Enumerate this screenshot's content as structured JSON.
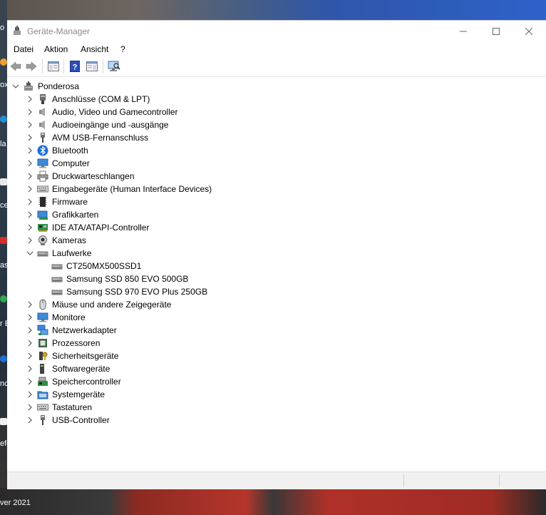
{
  "window": {
    "title": "Geräte-Manager"
  },
  "menu": [
    "Datei",
    "Aktion",
    "Ansicht",
    "?"
  ],
  "toolbar": {
    "buttons": [
      "back-icon",
      "forward-icon",
      "properties-icon",
      "help-icon",
      "update-driver-icon",
      "scan-hardware-icon"
    ]
  },
  "tree": {
    "root": "Ponderosa",
    "categories": [
      {
        "label": "Anschlüsse (COM & LPT)",
        "icon": "port-icon",
        "expanded": false
      },
      {
        "label": "Audio, Video und Gamecontroller",
        "icon": "speaker-icon",
        "expanded": false
      },
      {
        "label": "Audioeingänge und -ausgänge",
        "icon": "speaker-icon",
        "expanded": false
      },
      {
        "label": "AVM USB-Fernanschluss",
        "icon": "usb-icon",
        "expanded": false
      },
      {
        "label": "Bluetooth",
        "icon": "bluetooth-icon",
        "expanded": false
      },
      {
        "label": "Computer",
        "icon": "monitor-icon",
        "expanded": false
      },
      {
        "label": "Druckwarteschlangen",
        "icon": "printer-icon",
        "expanded": false
      },
      {
        "label": "Eingabegeräte (Human Interface Devices)",
        "icon": "keyboard-icon",
        "expanded": false
      },
      {
        "label": "Firmware",
        "icon": "chip-icon",
        "expanded": false
      },
      {
        "label": "Grafikkarten",
        "icon": "display-adapter-icon",
        "expanded": false
      },
      {
        "label": "IDE ATA/ATAPI-Controller",
        "icon": "controller-card-icon",
        "expanded": false
      },
      {
        "label": "Kameras",
        "icon": "camera-icon",
        "expanded": false
      },
      {
        "label": "Laufwerke",
        "icon": "drive-icon",
        "expanded": true,
        "children": [
          "CT250MX500SSD1",
          "Samsung SSD 850 EVO 500GB",
          "Samsung SSD 970 EVO Plus 250GB"
        ]
      },
      {
        "label": "Mäuse und andere Zeigegeräte",
        "icon": "mouse-icon",
        "expanded": false
      },
      {
        "label": "Monitore",
        "icon": "monitor-icon",
        "expanded": false
      },
      {
        "label": "Netzwerkadapter",
        "icon": "network-icon",
        "expanded": false
      },
      {
        "label": "Prozessoren",
        "icon": "processor-icon",
        "expanded": false
      },
      {
        "label": "Sicherheitsgeräte",
        "icon": "security-key-icon",
        "expanded": false
      },
      {
        "label": "Softwaregeräte",
        "icon": "software-device-icon",
        "expanded": false
      },
      {
        "label": "Speichercontroller",
        "icon": "storage-controller-icon",
        "expanded": false
      },
      {
        "label": "Systemgeräte",
        "icon": "system-folder-icon",
        "expanded": false
      },
      {
        "label": "Tastaturen",
        "icon": "keyboard-icon",
        "expanded": false
      },
      {
        "label": "USB-Controller",
        "icon": "usb-icon",
        "expanded": false
      }
    ]
  },
  "desktop": {
    "fragments": [
      "o",
      "ox",
      "la",
      "ce",
      "as",
      "r E",
      "nc",
      "efe"
    ],
    "date_fragment": "ver 2021"
  },
  "colors": {
    "accent": "#1e6ed8",
    "tree_text": "#000000",
    "chevron": "#555555"
  }
}
